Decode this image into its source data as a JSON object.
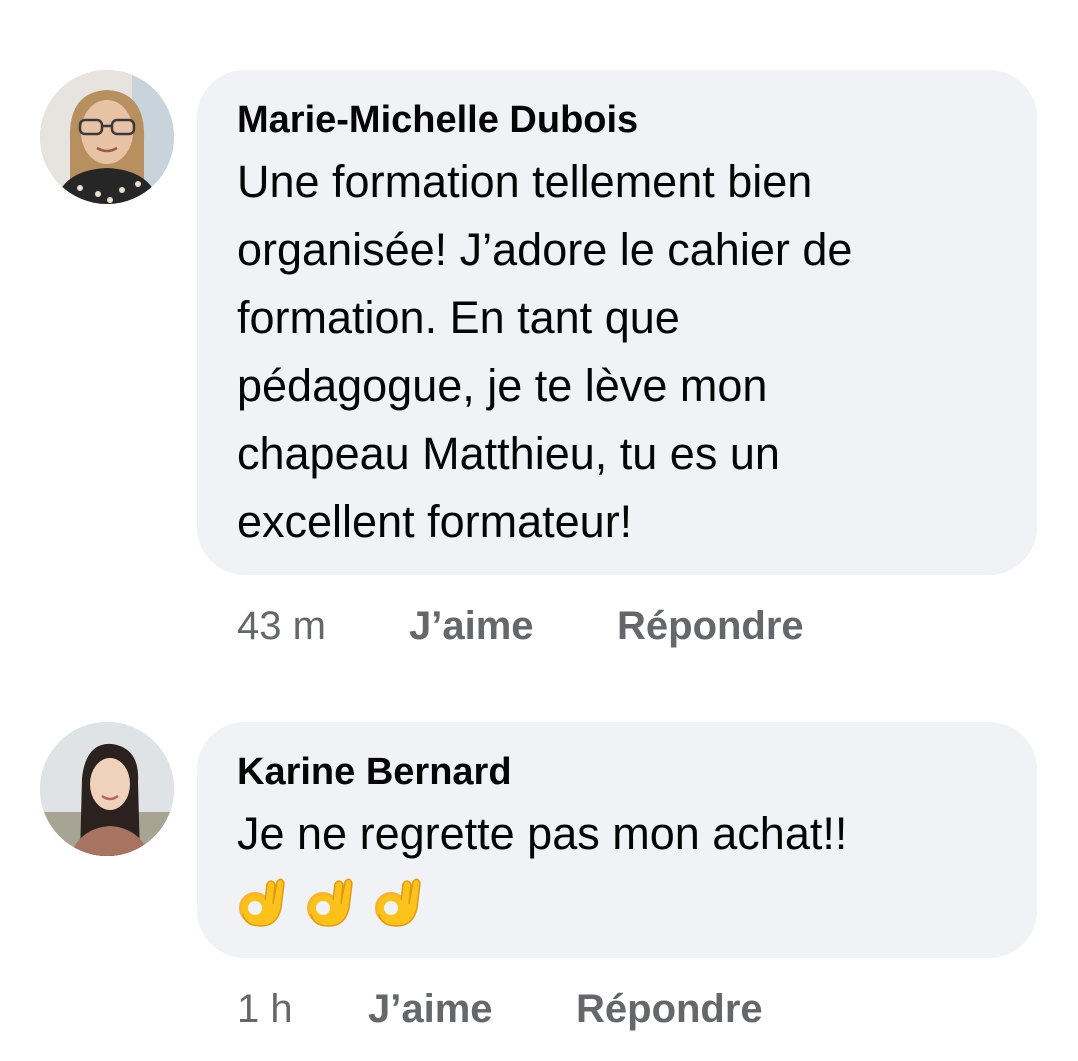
{
  "comments": [
    {
      "author": "Marie-Michelle Dubois",
      "text": "Une formation tellement bien\norganisée! J’adore le cahier de\nformation. En tant que\npédagogue, je te lève mon\nchapeau Matthieu, tu es un\nexcellent formateur!",
      "time": "43 m",
      "like_label": "J’aime",
      "reply_label": "Répondre"
    },
    {
      "author": "Karine Bernard",
      "text": "Je ne regrette pas mon achat!!",
      "emojis": [
        "ok-hand-emoji",
        "ok-hand-emoji",
        "ok-hand-emoji"
      ],
      "time": "1 h",
      "like_label": "J’aime",
      "reply_label": "Répondre"
    }
  ],
  "colors": {
    "bubble": "#f0f2f5",
    "author_text": "#050505",
    "meta_text": "#65676b"
  }
}
